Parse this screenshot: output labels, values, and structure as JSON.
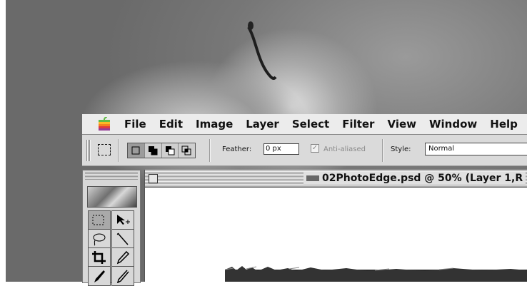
{
  "menubar": {
    "apple_icon": "apple-icon",
    "items": [
      "File",
      "Edit",
      "Image",
      "Layer",
      "Select",
      "Filter",
      "View",
      "Window",
      "Help"
    ]
  },
  "options_bar": {
    "marquee_icon": "rect-marquee-icon",
    "selection_modes": [
      "new-selection-icon",
      "add-selection-icon",
      "subtract-selection-icon",
      "intersect-selection-icon"
    ],
    "feather_label": "Feather:",
    "feather_value": "0 px",
    "anti_aliased_label": "Anti-aliased",
    "anti_aliased_checked": true,
    "style_label": "Style:",
    "style_value": "Normal"
  },
  "toolbox": {
    "tools": [
      "rect-marquee-icon",
      "move-icon",
      "lasso-icon",
      "magic-wand-icon",
      "crop-icon",
      "eyedropper-icon",
      "brush-icon",
      "pencil-icon"
    ]
  },
  "document": {
    "title": "02PhotoEdge.psd @ 50% (Layer 1,R"
  },
  "colors": {
    "menubar": "#ececec",
    "panel": "#dadada",
    "background_photo": "#7a7a7a"
  }
}
